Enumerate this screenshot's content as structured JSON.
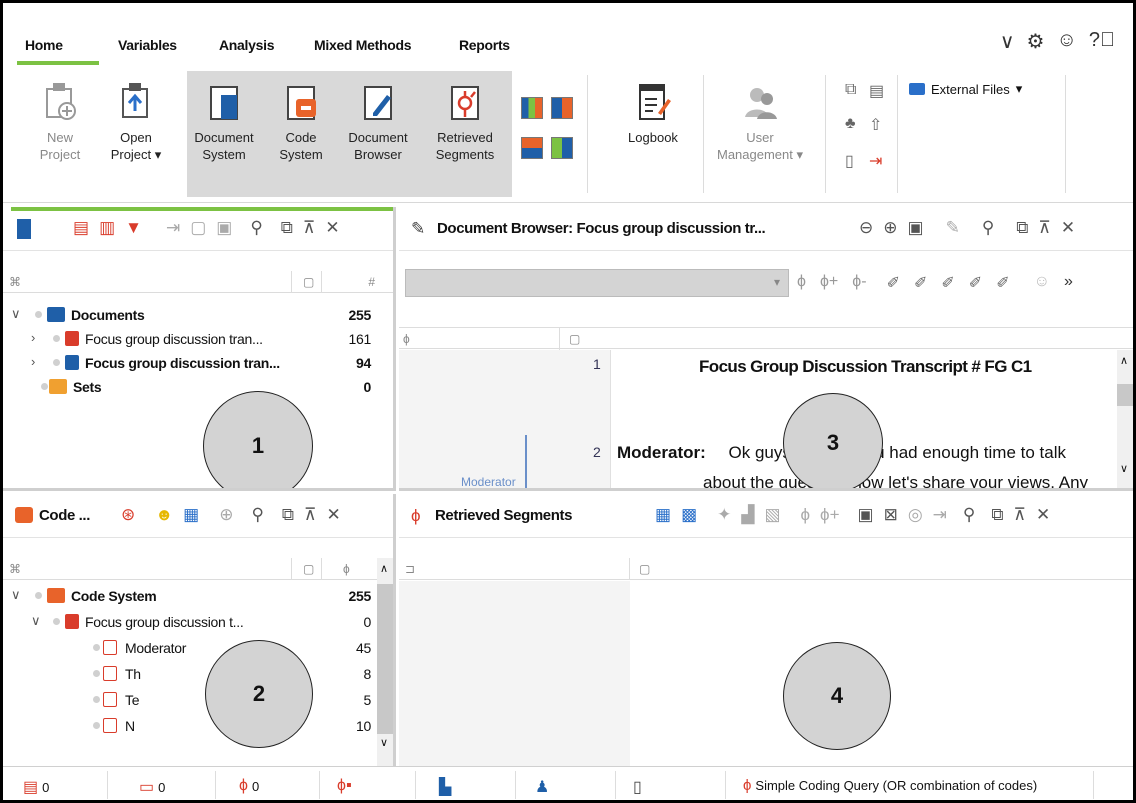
{
  "tabs": {
    "home": "Home",
    "variables": "Variables",
    "analysis": "Analysis",
    "mixed_methods": "Mixed Methods",
    "reports": "Reports"
  },
  "ribbon": {
    "new_project": [
      "New",
      "Project"
    ],
    "open_project": [
      "Open",
      "Project"
    ],
    "document_system": [
      "Document",
      "System"
    ],
    "code_system": [
      "Code",
      "System"
    ],
    "document_browser": [
      "Document",
      "Browser"
    ],
    "retrieved_segments": [
      "Retrieved",
      "Segments"
    ],
    "logbook": "Logbook",
    "user_management": [
      "User",
      "Management"
    ],
    "external_files": "External Files"
  },
  "documents_pane": {
    "col_hash": "#",
    "rows": [
      {
        "label": "Documents",
        "count": "255"
      },
      {
        "label": "Focus group discussion tran...",
        "count": "161"
      },
      {
        "label": "Focus group discussion tran...",
        "count": "94"
      },
      {
        "label": "Sets",
        "count": "0"
      }
    ],
    "marker": "1"
  },
  "browser_pane": {
    "title": "Document Browser: Focus group discussion tr...",
    "line1_num": "1",
    "heading": "Focus Group Discussion Transcript # FG C1",
    "line2_num": "2",
    "speaker": "Moderator:",
    "text1": "Ok guys",
    "text2": "ou had enough time to talk",
    "text3": "about the question, now let's share your views. Any",
    "margin_label": "Moderator",
    "marker": "3"
  },
  "code_pane": {
    "title": "Code ...",
    "rows": [
      {
        "label": "Code System",
        "count": "255"
      },
      {
        "label": "Focus group discussion t...",
        "count": "0"
      },
      {
        "label": "Moderator",
        "count": "45"
      },
      {
        "label": "Th",
        "count": "8"
      },
      {
        "label": "Te",
        "count": "5"
      },
      {
        "label": "N",
        "count": "10"
      }
    ],
    "marker": "2"
  },
  "segments_pane": {
    "title": "Retrieved Segments",
    "marker": "4"
  },
  "status": {
    "docs": "0",
    "codes": "0",
    "segments": "0",
    "query": "Simple Coding Query (OR combination of codes)"
  },
  "colors": {
    "accent_green": "#7cc243",
    "folder_blue": "#1f5fa8",
    "code_orange": "#e8632a",
    "red_icon": "#d93c2b"
  }
}
